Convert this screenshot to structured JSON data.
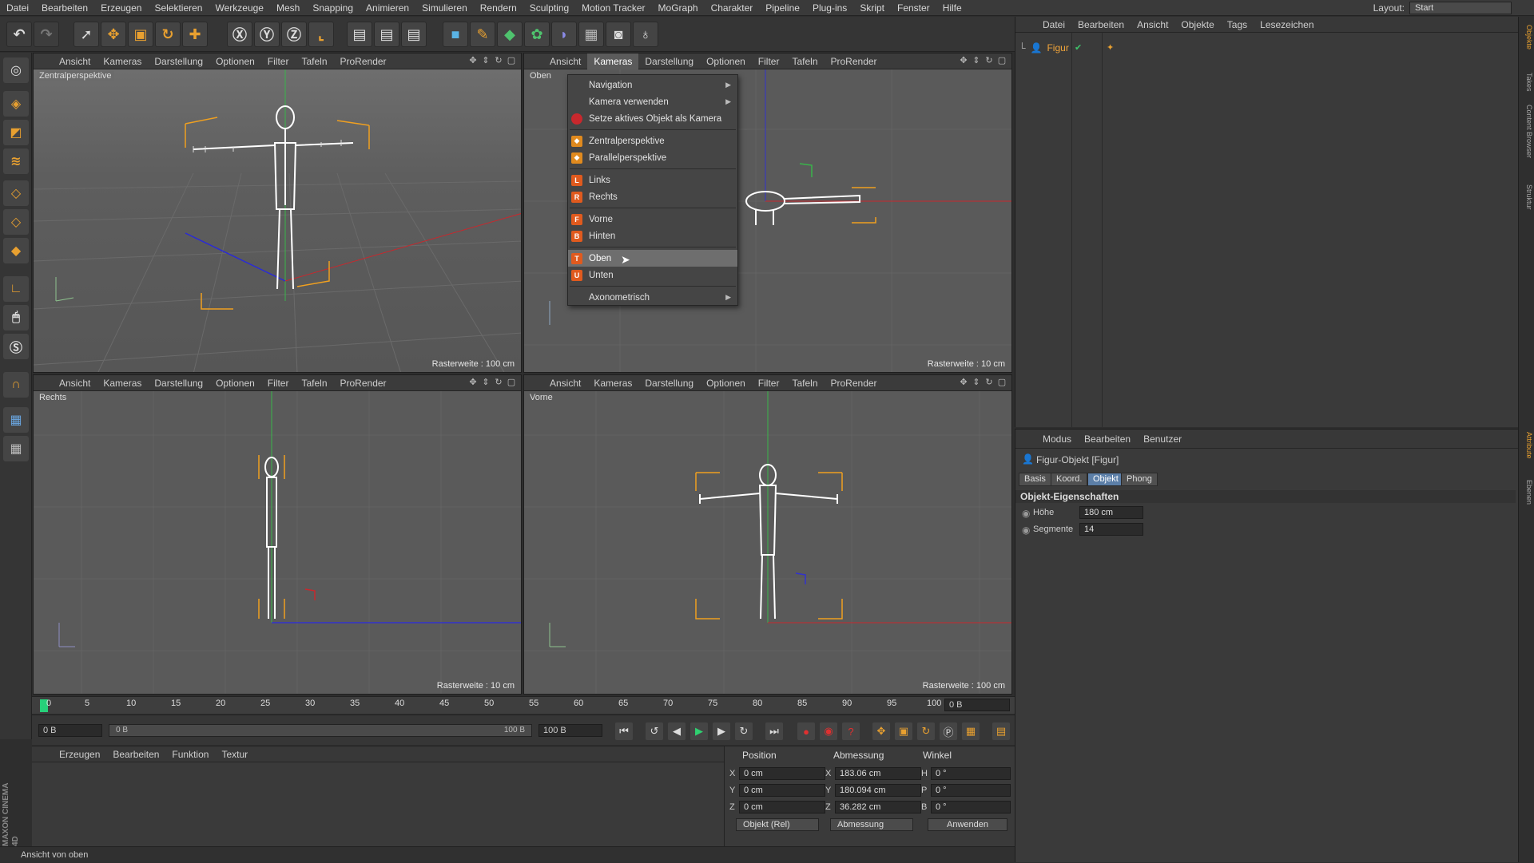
{
  "menubar": {
    "items": [
      "Datei",
      "Bearbeiten",
      "Erzeugen",
      "Selektieren",
      "Werkzeuge",
      "Mesh",
      "Snapping",
      "Animieren",
      "Simulieren",
      "Rendern",
      "Sculpting",
      "Motion Tracker",
      "MoGraph",
      "Charakter",
      "Pipeline",
      "Plug-ins",
      "Skript",
      "Fenster",
      "Hilfe"
    ],
    "layout_label": "Layout:",
    "layout_value": "Start"
  },
  "viewport_menu": [
    "Ansicht",
    "Kameras",
    "Darstellung",
    "Optionen",
    "Filter",
    "Tafeln",
    "ProRender"
  ],
  "viewports": {
    "tl": {
      "label": "Zentralperspektive",
      "raster": "Rasterweite : 100 cm"
    },
    "tr": {
      "label": "Oben",
      "raster": "Rasterweite : 10 cm"
    },
    "bl": {
      "label": "Rechts",
      "raster": "Rasterweite : 10 cm"
    },
    "br": {
      "label": "Vorne",
      "raster": "Rasterweite : 100 cm"
    }
  },
  "kameras_menu": {
    "items": [
      {
        "label": "Navigation",
        "sub": true
      },
      {
        "label": "Kamera verwenden",
        "sub": true
      },
      {
        "label": "Setze aktives Objekt als Kamera"
      },
      {
        "label": "Zentralperspektive"
      },
      {
        "label": "Parallelperspektive"
      },
      {
        "label": "Links",
        "key": "L"
      },
      {
        "label": "Rechts",
        "key": "R"
      },
      {
        "label": "Vorne",
        "key": "F"
      },
      {
        "label": "Hinten",
        "key": "B"
      },
      {
        "label": "Oben",
        "key": "T",
        "selected": true
      },
      {
        "label": "Unten",
        "key": "U"
      },
      {
        "label": "Axonometrisch",
        "sub": true
      }
    ]
  },
  "timeline": {
    "ticks": [
      "0",
      "5",
      "10",
      "15",
      "20",
      "25",
      "30",
      "35",
      "40",
      "45",
      "50",
      "55",
      "60",
      "65",
      "70",
      "75",
      "80",
      "85",
      "90",
      "95",
      "100"
    ],
    "current_frame": "0 B"
  },
  "transport": {
    "start": "0 B",
    "slider_start": "0 B",
    "slider_end": "100 B",
    "end": "100 B"
  },
  "material_manager": {
    "menu": [
      "Erzeugen",
      "Bearbeiten",
      "Funktion",
      "Textur"
    ]
  },
  "coordinates": {
    "headers": [
      "Position",
      "Abmessung",
      "Winkel"
    ],
    "rows": [
      {
        "axis": "X",
        "pos": "0 cm",
        "size_axis": "X",
        "size": "183.06 cm",
        "rot_axis": "H",
        "rot": "0 °"
      },
      {
        "axis": "Y",
        "pos": "0 cm",
        "size_axis": "Y",
        "size": "180.094 cm",
        "rot_axis": "P",
        "rot": "0 °"
      },
      {
        "axis": "Z",
        "pos": "0 cm",
        "size_axis": "Z",
        "size": "36.282 cm",
        "rot_axis": "B",
        "rot": "0 °"
      }
    ],
    "mode": "Objekt (Rel)",
    "size_mode": "Abmessung",
    "apply": "Anwenden"
  },
  "status": "Ansicht von oben",
  "object_manager": {
    "menu": [
      "Datei",
      "Bearbeiten",
      "Ansicht",
      "Objekte",
      "Tags",
      "Lesezeichen"
    ],
    "object": "Figur"
  },
  "attribute_manager": {
    "menu": [
      "Modus",
      "Bearbeiten",
      "Benutzer"
    ],
    "title": "Figur-Objekt [Figur]",
    "tabs": [
      "Basis",
      "Koord.",
      "Objekt",
      "Phong"
    ],
    "section": "Objekt-Eigenschaften",
    "props": [
      {
        "label": "Höhe",
        "value": "180 cm"
      },
      {
        "label": "Segmente",
        "value": "14"
      }
    ]
  },
  "side_tabs": [
    "Objekte",
    "Takes",
    "Content Browser",
    "Struktur",
    "Attribute",
    "Ebenen"
  ],
  "brand": "MAXON CINEMA 4D"
}
